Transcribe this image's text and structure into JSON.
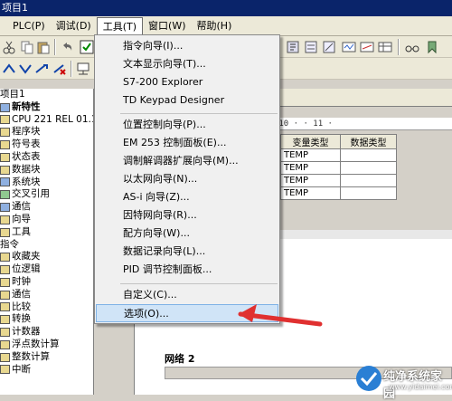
{
  "window": {
    "title": "项目1"
  },
  "menubar": {
    "items": [
      {
        "label": "PLC(P)"
      },
      {
        "label": "调试(D)"
      },
      {
        "label": "工具(T)"
      },
      {
        "label": "窗口(W)"
      },
      {
        "label": "帮助(H)"
      }
    ]
  },
  "tools_menu": {
    "items": [
      "指令向导(I)...",
      "文本显示向导(T)...",
      "S7-200 Explorer",
      "TD Keypad Designer",
      "位置控制向导(P)...",
      "EM 253 控制面板(E)...",
      "调制解调器扩展向导(M)...",
      "以太网向导(N)...",
      "AS-i 向导(Z)...",
      "因特网向导(R)...",
      "配方向导(W)...",
      "数据记录向导(L)...",
      "PID 调节控制面板...",
      "自定义(C)...",
      "选项(O)..."
    ]
  },
  "tree": {
    "items": [
      {
        "label": "项目1"
      },
      {
        "label": "新特性"
      },
      {
        "label": "CPU 221 REL 01.10"
      },
      {
        "label": "程序块"
      },
      {
        "label": "符号表"
      },
      {
        "label": "状态表"
      },
      {
        "label": "数据块"
      },
      {
        "label": "系统块"
      },
      {
        "label": "交叉引用"
      },
      {
        "label": "通信"
      },
      {
        "label": "向导"
      },
      {
        "label": "工具"
      },
      {
        "label": "指令"
      },
      {
        "label": "收藏夹"
      },
      {
        "label": "位逻辑"
      },
      {
        "label": "时钟"
      },
      {
        "label": "通信"
      },
      {
        "label": "比较"
      },
      {
        "label": "转换"
      },
      {
        "label": "计数器"
      },
      {
        "label": "浮点数计算"
      },
      {
        "label": "整数计算"
      },
      {
        "label": "中断"
      }
    ]
  },
  "ruler": {
    "text": "· 7 · · 8 · · 9 · · 10 · · 11 ·"
  },
  "var_table": {
    "headers": [
      "变量类型",
      "数据类型"
    ],
    "rows": [
      [
        "TEMP",
        ""
      ],
      [
        "TEMP",
        ""
      ],
      [
        "TEMP",
        ""
      ],
      [
        "TEMP",
        ""
      ]
    ]
  },
  "network": {
    "label": "网络 2"
  },
  "watermark": {
    "title": "纯净系统家园",
    "url": "www.yidaimei.com"
  },
  "colors": {
    "menu_highlight": "#d0e4f7",
    "arrow": "#e03030",
    "titlebar": "#0a246a"
  }
}
